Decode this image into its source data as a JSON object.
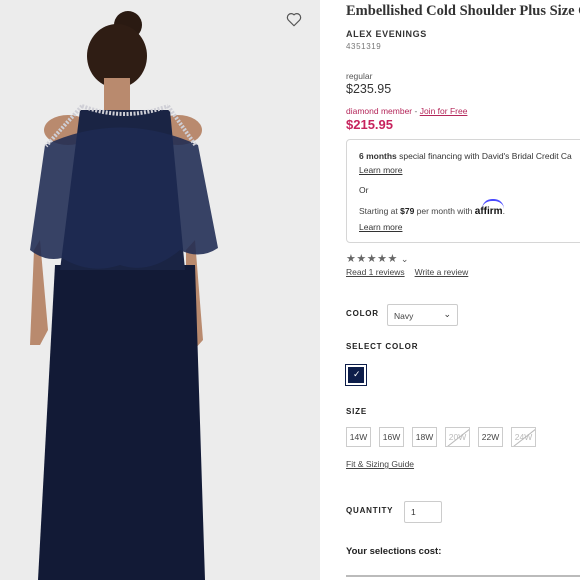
{
  "product": {
    "title": "Embellished Cold Shoulder Plus Size G",
    "brand": "ALEX EVENINGS",
    "sku": "4351319"
  },
  "pricing": {
    "regular_label": "regular",
    "regular_price": "$235.95",
    "member_label": "diamond member",
    "separator": " - ",
    "join_link": "Join for Free",
    "member_price": "$215.95"
  },
  "financing": {
    "line1_bold": "6 months",
    "line1_text": " special financing with David's Bridal Credit Ca",
    "learn_more_1": "Learn more",
    "or_text": "Or",
    "line2_prefix": "Starting at ",
    "line2_amount": "$79",
    "line2_suffix": " per month with ",
    "affirm_logo": "affirm",
    "learn_more_2": "Learn more"
  },
  "reviews": {
    "stars": "★★★★★",
    "read_link": "Read 1 reviews",
    "write_link": "Write a review",
    "rating_out_of_5": 0
  },
  "color": {
    "label": "COLOR",
    "selected": "Navy",
    "select_label": "SELECT COLOR",
    "swatch_color": "#0d1d4a"
  },
  "size": {
    "label": "SIZE",
    "options": [
      "14W",
      "16W",
      "18W",
      "20W",
      "22W",
      "24W"
    ],
    "unavailable": [
      "20W",
      "24W"
    ],
    "fit_link": "Fit & Sizing Guide"
  },
  "quantity": {
    "label": "QUANTITY",
    "value": "1"
  },
  "summary": {
    "cost_label": "Your selections cost:"
  },
  "colors": {
    "member_price": "#c7235d",
    "navy": "#0d1d4a",
    "photo_bg": "#ececec"
  },
  "icons": {
    "wishlist": "heart-outline-icon",
    "dropdown": "chevron-down-icon",
    "check": "checkmark-icon"
  }
}
